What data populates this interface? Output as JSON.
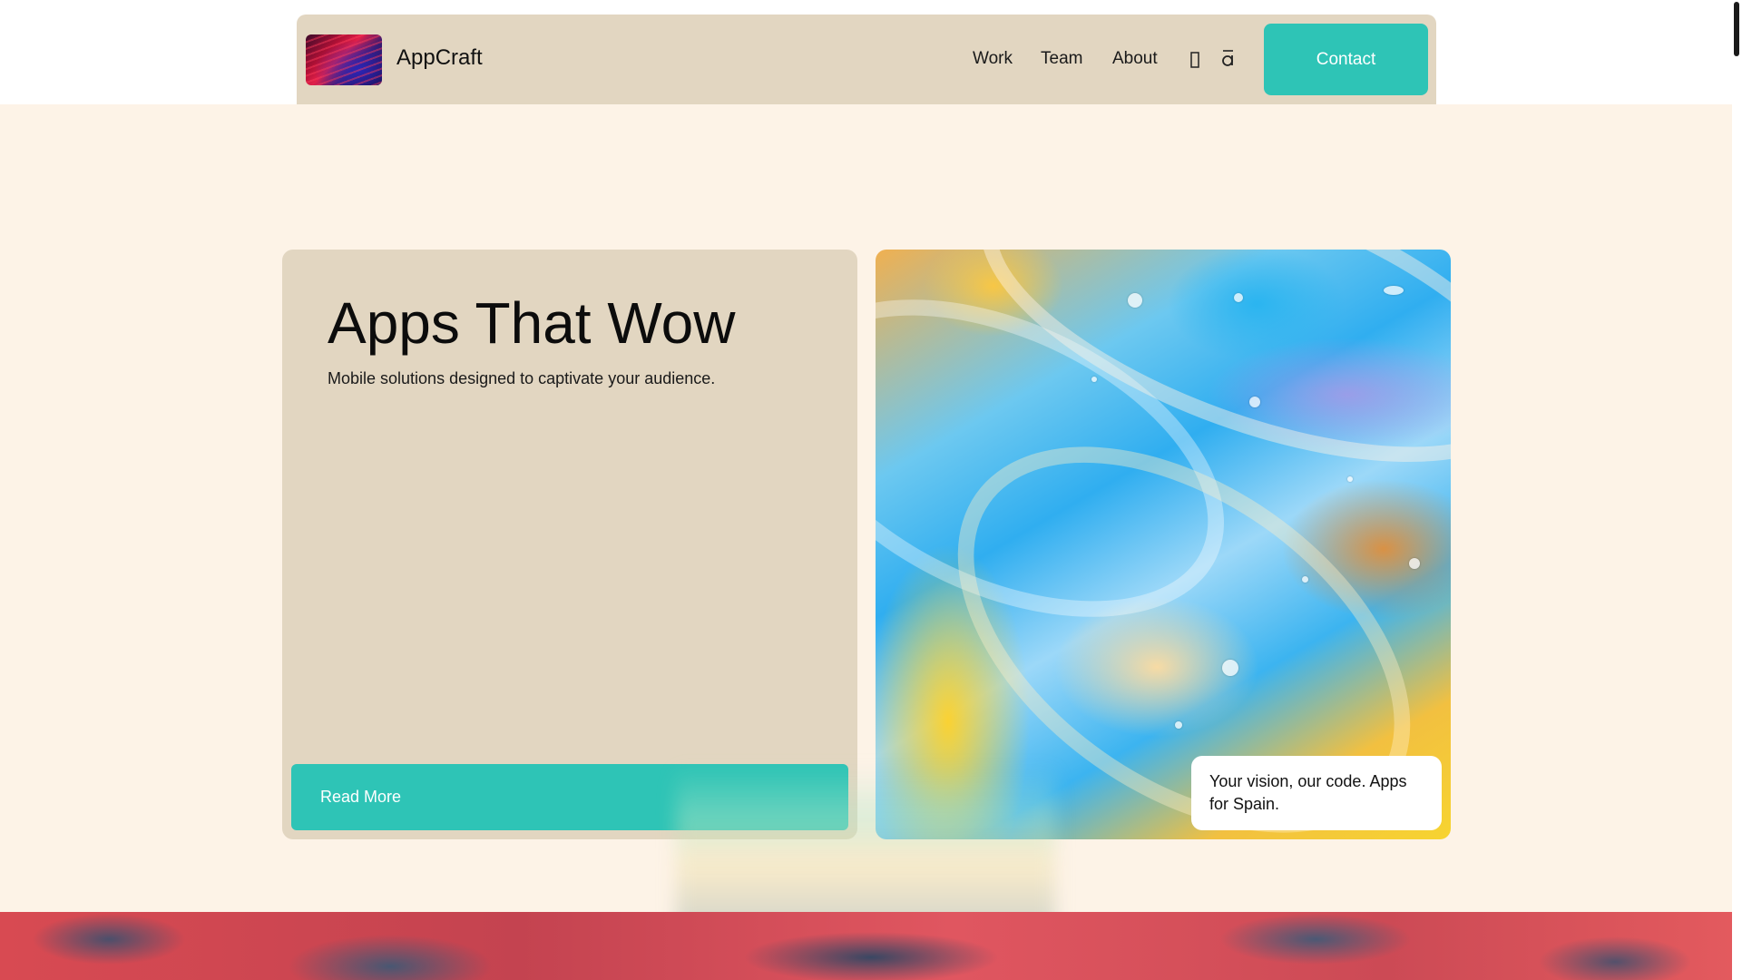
{
  "header": {
    "brand": "AppCraft",
    "logo_icon": "abstract-logo-image",
    "nav": [
      {
        "label": "Work"
      },
      {
        "label": "Team"
      },
      {
        "label": "About"
      }
    ],
    "icons": [
      "glyph-icon",
      "alpha-icon"
    ],
    "contact_label": "Contact"
  },
  "hero": {
    "title": "Apps That Wow",
    "subtitle": "Mobile solutions designed to captivate your audience.",
    "cta_label": "Read More",
    "caption": "Your vision, our code. Apps for Spain."
  },
  "colors": {
    "accent": "#2ec4b6",
    "card": "#e2d6c1",
    "page_bg": "#fdf3e7"
  }
}
